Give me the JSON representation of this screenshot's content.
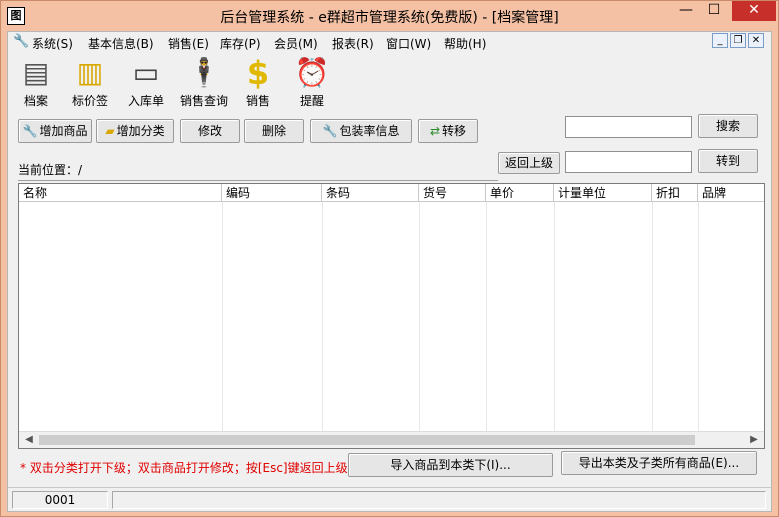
{
  "window": {
    "title": "后台管理系统 - e群超市管理系统(免费版) - [档案管理]",
    "app_icon_glyph": "图",
    "min_glyph": "—",
    "max_glyph": "☐",
    "close_glyph": "✕"
  },
  "menu": {
    "items": [
      {
        "label": "系统(S)"
      },
      {
        "label": "基本信息(B)"
      },
      {
        "label": "销售(E)"
      },
      {
        "label": "库存(P)"
      },
      {
        "label": "会员(M)"
      },
      {
        "label": "报表(R)"
      },
      {
        "label": "窗口(W)"
      },
      {
        "label": "帮助(H)"
      }
    ],
    "mdi_min": "_",
    "mdi_restore": "❐",
    "mdi_close": "✕"
  },
  "toolbar": {
    "items": [
      {
        "label": "档案",
        "icon": "archive-icon",
        "glyph": "▤"
      },
      {
        "label": "标价签",
        "icon": "price-tag-icon",
        "glyph": "▥"
      },
      {
        "label": "入库单",
        "icon": "stock-in-icon",
        "glyph": "▭"
      },
      {
        "label": "销售查询",
        "icon": "sales-query-icon",
        "glyph": "🕴"
      },
      {
        "label": "销售",
        "icon": "dollar-icon",
        "glyph": "$"
      },
      {
        "label": "提醒",
        "icon": "alarm-clock-icon",
        "glyph": "⏰"
      }
    ]
  },
  "actions": {
    "add_product": "增加商品",
    "add_category": "增加分类",
    "edit": "修改",
    "delete": "删除",
    "package_rate": "包装率信息",
    "transfer": "转移",
    "search": "搜索",
    "back_up": "返回上级",
    "goto": "转到",
    "search_value": "",
    "goto_value": ""
  },
  "location": {
    "label": "当前位置：/"
  },
  "grid": {
    "columns": [
      "名称",
      "编码",
      "条码",
      "货号",
      "单价",
      "计量单位",
      "折扣",
      "品牌"
    ],
    "rows": []
  },
  "hint": "* 双击分类打开下级；双击商品打开修改；按[Esc]键返回上级",
  "bottom_actions": {
    "import": "导入商品到本类下(I)...",
    "export": "导出本类及子类所有商品(E)..."
  },
  "status": {
    "code": "0001",
    "message": ""
  },
  "colors": {
    "frame": "#f5c1a4",
    "close": "#c7302a",
    "hint": "#e00000",
    "dollar": "#e0b800"
  }
}
